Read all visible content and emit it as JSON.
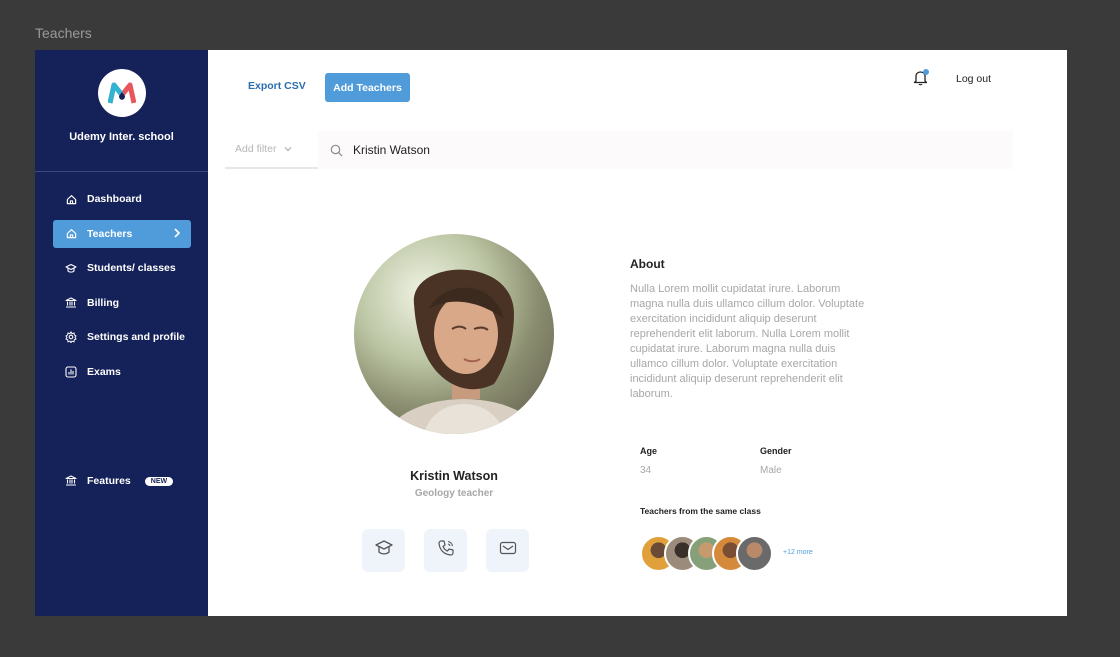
{
  "frame": {
    "label": "Teachers"
  },
  "sidebar": {
    "school_name": "Udemy Inter. school",
    "items": [
      {
        "label": "Dashboard",
        "icon": "home-icon"
      },
      {
        "label": "Teachers",
        "icon": "home-icon",
        "active": true
      },
      {
        "label": "Students/ classes",
        "icon": "graduation-cap-icon"
      },
      {
        "label": "Billing",
        "icon": "bank-icon"
      },
      {
        "label": "Settings and profile",
        "icon": "gear-icon"
      },
      {
        "label": "Exams",
        "icon": "chart-icon"
      }
    ],
    "features": {
      "label": "Features",
      "badge": "NEW",
      "icon": "bank-icon"
    }
  },
  "header": {
    "export_label": "Export CSV",
    "add_label": "Add Teachers",
    "logout_label": "Log out"
  },
  "filter": {
    "placeholder": "Add filter"
  },
  "search": {
    "value": "Kristin Watson"
  },
  "profile": {
    "name": "Kristin Watson",
    "role": "Geology teacher",
    "actions": [
      "graduation-cap-icon",
      "phone-icon",
      "mail-icon"
    ]
  },
  "about": {
    "title": "About",
    "text": "Nulla Lorem mollit cupidatat irure. Laborum magna nulla duis ullamco cillum dolor. Voluptate exercitation incididunt aliquip deserunt reprehenderit elit laborum. Nulla Lorem mollit cupidatat irure. Laborum magna nulla duis ullamco cillum dolor. Voluptate exercitation incididunt aliquip deserunt reprehenderit elit laborum."
  },
  "details": {
    "age_label": "Age",
    "age_value": "34",
    "gender_label": "Gender",
    "gender_value": "Male"
  },
  "same_class": {
    "title": "Teachers from the same class",
    "more": "+12 more",
    "colors": [
      "#e0a13a",
      "#5a5a5a",
      "#86a17a",
      "#d48a3a",
      "#8a8a8a"
    ]
  },
  "colors": {
    "sidebar": "#152259",
    "accent": "#509CDB"
  }
}
